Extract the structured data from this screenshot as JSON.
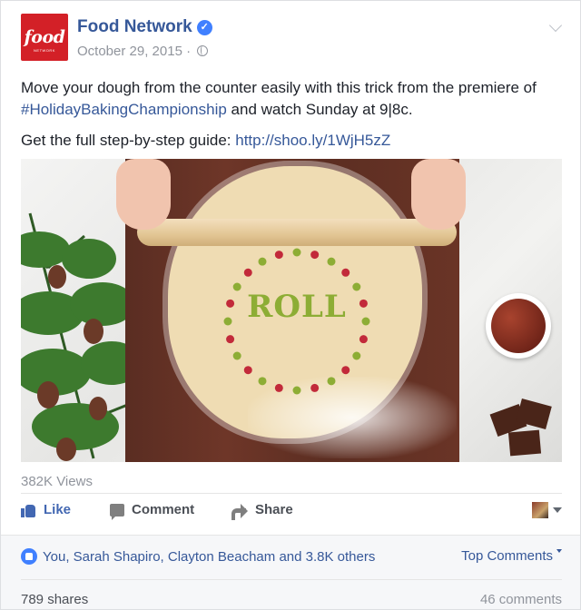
{
  "post": {
    "page_name": "Food Network",
    "avatar_logo_text": "food",
    "avatar_logo_subtext": "NETWORK",
    "date": "October 29, 2015",
    "date_separator": "·",
    "text_line1_a": "Move your dough from the counter easily with this trick from the premiere of ",
    "hashtag": "#HolidayBakingChampionship",
    "text_line1_b": " and watch Sunday at 9|8c.",
    "text_line2_a": "Get the full step-by-step guide: ",
    "link": "http://shoo.ly/1WjH5zZ"
  },
  "media": {
    "overlay_text": "ROLL",
    "dot_colors": [
      "#8dad35",
      "#c22a3a"
    ]
  },
  "stats": {
    "views": "382K Views"
  },
  "actions": {
    "like": "Like",
    "comment": "Comment",
    "share": "Share"
  },
  "reactions": {
    "likes_text": "You, Sarah Shapiro, Clayton Beacham and 3.8K others",
    "top_comments": "Top Comments",
    "shares": "789 shares",
    "comments": "46 comments"
  },
  "colors": {
    "link": "#365899",
    "accent": "#4267b2",
    "brand_red": "#d32027"
  },
  "icons": [
    "verified-icon",
    "globe-icon",
    "chevron-down-icon",
    "like-icon",
    "comment-icon",
    "share-icon",
    "caret-down-icon",
    "like-badge-icon"
  ]
}
